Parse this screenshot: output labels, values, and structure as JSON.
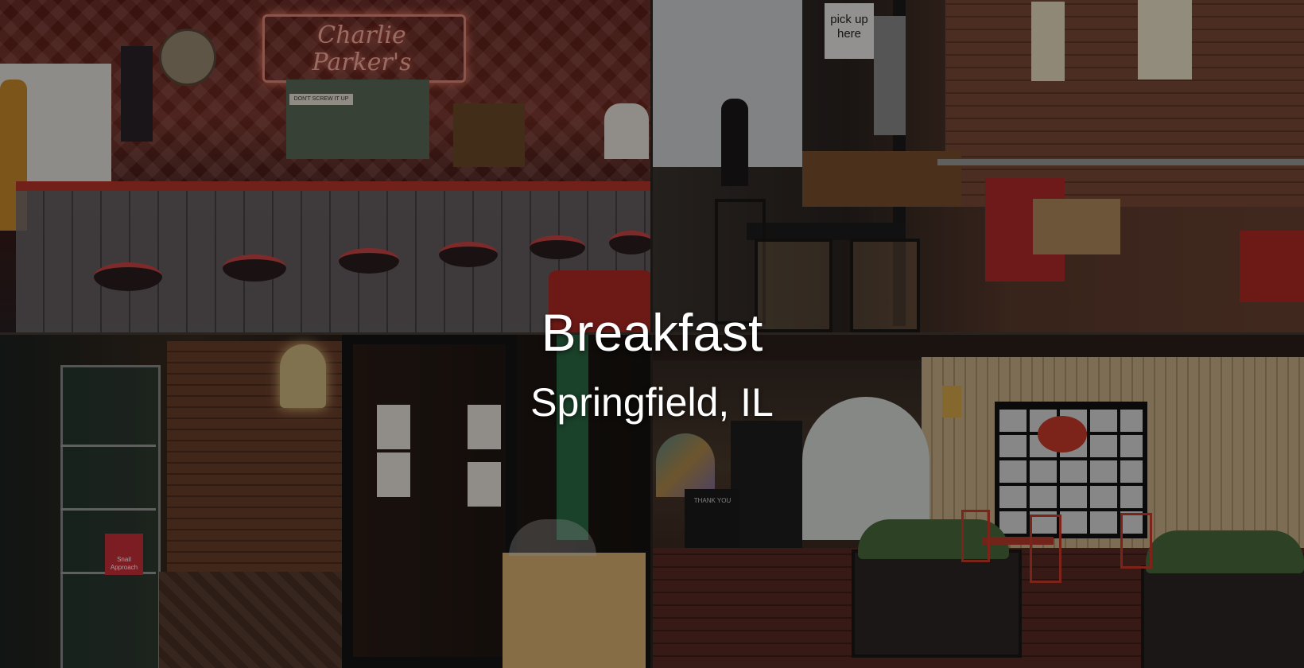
{
  "overlay": {
    "title": "Breakfast",
    "subtitle": "Springfield, IL"
  },
  "photos": {
    "diner": {
      "neon_sign": "Charlie Parker's",
      "counter_sign": "DON'T SCREW IT UP"
    },
    "cafe": {
      "pickup_sign": "pick up here"
    },
    "hallway": {
      "book_title": "Snail Approach"
    },
    "courtyard": {
      "stand_sign": "THANK YOU"
    }
  },
  "colors": {
    "overlay_text": "#ffffff",
    "neon": "#f2b0a0",
    "brick": "#7a4a36"
  }
}
